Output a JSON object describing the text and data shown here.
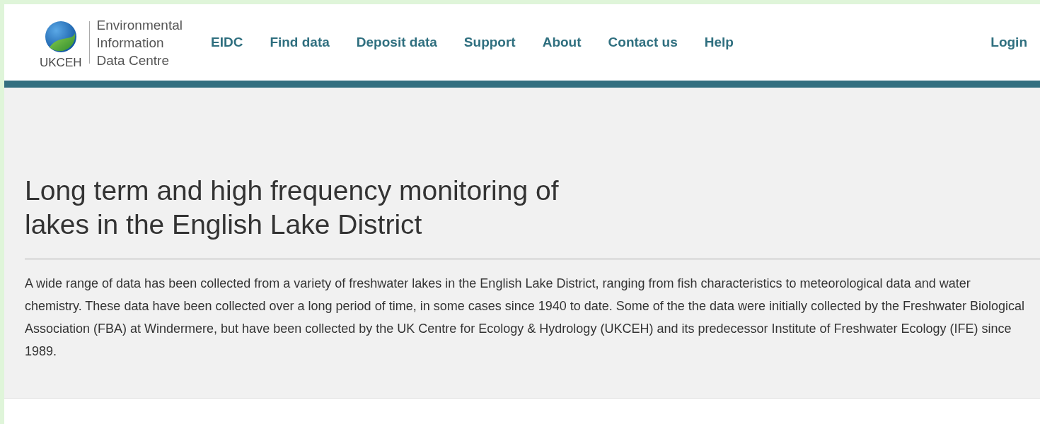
{
  "logo": {
    "org": "UKCEH",
    "name_lines": [
      "Environmental",
      "Information",
      "Data Centre"
    ]
  },
  "nav": [
    {
      "label": "EIDC"
    },
    {
      "label": "Find data"
    },
    {
      "label": "Deposit data"
    },
    {
      "label": "Support"
    },
    {
      "label": "About"
    },
    {
      "label": "Contact us"
    },
    {
      "label": "Help"
    }
  ],
  "login": "Login",
  "title": "Long term and high frequency monitoring of lakes in the English Lake District",
  "description": "A wide range of data has been collected from a variety of freshwater lakes in the English Lake District, ranging from fish characteristics to meteorological data and water chemistry. These data have been collected over a long period of time, in some cases since 1940 to date. Some of the the data were initially collected by the Freshwater Biological Association (FBA) at Windermere, but have been collected by the UK Centre for Ecology & Hydrology (UKCEH) and its predecessor Institute of Freshwater Ecology (IFE) since 1989."
}
